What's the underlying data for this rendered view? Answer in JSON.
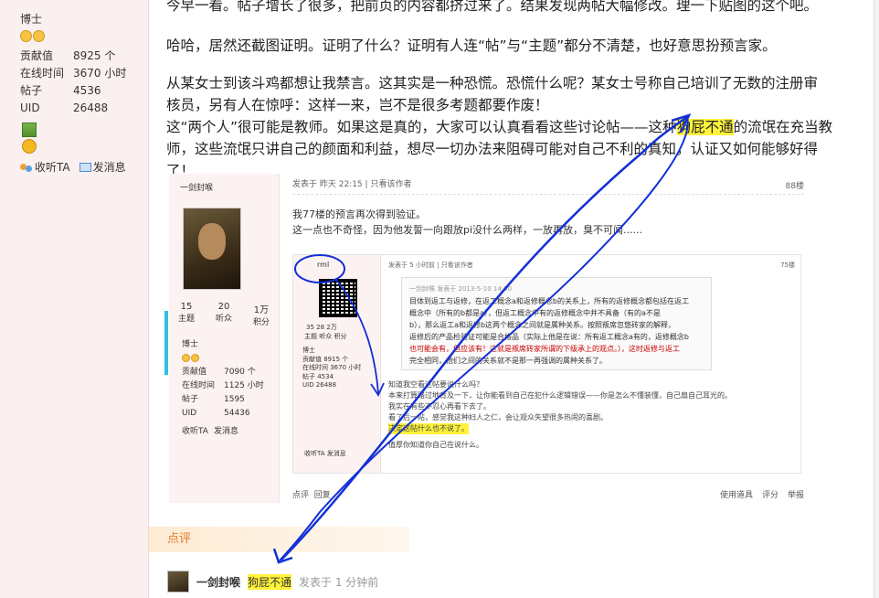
{
  "sidebar": {
    "user_title": "博士",
    "stats": [
      {
        "label": "贡献值",
        "value": "8925 个"
      },
      {
        "label": "在线时间",
        "value": "3670 小时"
      },
      {
        "label": "帖子",
        "value": "4536"
      },
      {
        "label": "UID",
        "value": "26488"
      }
    ],
    "follow_label": "收听TA",
    "message_label": "发消息"
  },
  "post": {
    "line1": "今早一看。帖子增长了很多，把前页的内容都挤过来了。结果发现两帖大幅修改。理一下贴图的这个吧。",
    "para2": "哈哈，居然还截图证明。证明了什么？证明有人连“帖”与“主题”都分不清楚，也好意思扮预言家。",
    "para3a": "从某女士到该斗鸡都想让我禁言。这其实是一种恐慌。恐慌什么呢？某女士号称自己培训了无数的注册审",
    "para3b": "核员，另有人在惊呼：这样一来，岂不是很多考题都要作废！",
    "para4a_pre": "这“两个人”很可能是教师。如果这是真的，大家可以认真看看这些讨论帖——这种",
    "para4a_hl": "狗屁不通",
    "para4a_post": "的流氓在充当教",
    "para4b": "师，这些流氓只讲自己的颜面和利益，想尽一切办法来阻碍可能对自己不利的真知，认证又如何能够好得",
    "para4c": "了！"
  },
  "screenshot": {
    "username": "一剑封喉",
    "posted": "发表于 昨天 22:15",
    "only_author": "只看该作者",
    "floor": "88楼",
    "msg1": "我77楼的预言再次得到验证。",
    "msg2": "这一点也不奇怪，因为他发誓一向跟放pi没什么两样，一放再放，臭不可闻......",
    "stats": [
      {
        "value": "15",
        "label": "主题"
      },
      {
        "value": "20",
        "label": "听众"
      },
      {
        "value": "1万",
        "label": "积分"
      }
    ],
    "title": "博士",
    "info": [
      {
        "label": "贡献值",
        "value": "7090 个"
      },
      {
        "label": "在线时间",
        "value": "1125 小时"
      },
      {
        "label": "帖子",
        "value": "1595"
      },
      {
        "label": "UID",
        "value": "54436"
      }
    ],
    "follow": "收听TA",
    "message": "发消息",
    "inner": {
      "name": "rml",
      "posted": "发表于 5 小时前",
      "only_author": "只看该作者",
      "floor": "75楼",
      "quote_head": "一剑封喉 发表于 2013-5-10 14:00",
      "quote1": "目体到返工与返修，在返工概念a和返修概念b的关系上，所有的返修概念都包括在返工",
      "quote2": "概念中（所有的b都是a），但返工概念中有的返修概念中并不具备（有的a不是",
      "quote3": "b），那么返工a和返修b这两个概念之间就是属种关系。按照叛席忽悠砖家的解释，",
      "quote4": "返修后的产品检验证可能是合格品（实际上他是在说：所有返工概念a有的，返修概念b",
      "quote5": "也可能会有，但应该有！这就是叛席砖家所谓的下级承上的观点。），这时返修与返工",
      "quote6": "完全相同，他们之间的关系就不是那一再强调的属种关系了。",
      "text1": "知道我空看这帖要说什么吗？",
      "text2": "本来打算路过地背及一下，让你能看到自己在犯什么逻辑错误——你是怎么不懂装懂，自己扇自己耳光的。",
      "text3": "我实在有些不忍心再看下去了。",
      "text4": "看了后一帖，感觉我这种妇人之仁，会让观众失望很多热闹的喜剧。",
      "text5": "决定这帖什么也不说了。",
      "text6": "值厚你知道你自己在说什么。",
      "stats": "35  28  2万",
      "stats_labels": "主题 听众 积分",
      "mini_title": "博士",
      "mini1": "贡献值 8915 个",
      "mini2": "在线时间 3670 小时",
      "mini3": "帖子 4534",
      "mini4": "UID 26488",
      "mini_act": "收听TA   发消息"
    },
    "foot_rate": "点评",
    "foot_reply": "回复",
    "foot_tools": "使用道具",
    "foot_score": "评分",
    "foot_report": "举报"
  },
  "review_label": "点评",
  "comment": {
    "user": "一剑封喉",
    "text": "狗屁不通",
    "time": "发表于 1 分钟前"
  },
  "colors": {
    "highlight": "#fff23a",
    "ink": "#1330d6",
    "review": "#e07b2a"
  }
}
